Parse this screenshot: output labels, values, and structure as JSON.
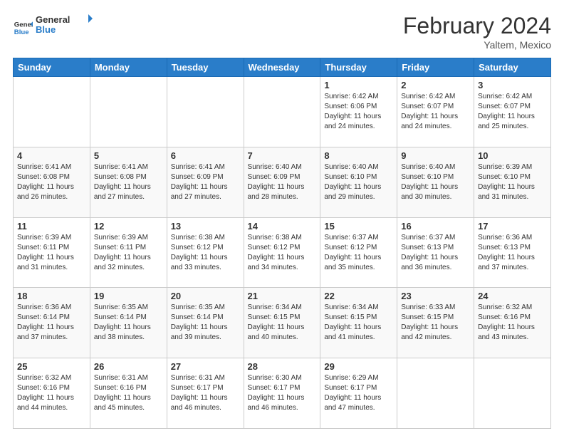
{
  "header": {
    "logo": {
      "general": "General",
      "blue": "Blue"
    },
    "title": "February 2024",
    "subtitle": "Yaltem, Mexico"
  },
  "weekdays": [
    "Sunday",
    "Monday",
    "Tuesday",
    "Wednesday",
    "Thursday",
    "Friday",
    "Saturday"
  ],
  "weeks": [
    [
      {
        "day": "",
        "info": ""
      },
      {
        "day": "",
        "info": ""
      },
      {
        "day": "",
        "info": ""
      },
      {
        "day": "",
        "info": ""
      },
      {
        "day": "1",
        "info": "Sunrise: 6:42 AM\nSunset: 6:06 PM\nDaylight: 11 hours and 24 minutes."
      },
      {
        "day": "2",
        "info": "Sunrise: 6:42 AM\nSunset: 6:07 PM\nDaylight: 11 hours and 24 minutes."
      },
      {
        "day": "3",
        "info": "Sunrise: 6:42 AM\nSunset: 6:07 PM\nDaylight: 11 hours and 25 minutes."
      }
    ],
    [
      {
        "day": "4",
        "info": "Sunrise: 6:41 AM\nSunset: 6:08 PM\nDaylight: 11 hours and 26 minutes."
      },
      {
        "day": "5",
        "info": "Sunrise: 6:41 AM\nSunset: 6:08 PM\nDaylight: 11 hours and 27 minutes."
      },
      {
        "day": "6",
        "info": "Sunrise: 6:41 AM\nSunset: 6:09 PM\nDaylight: 11 hours and 27 minutes."
      },
      {
        "day": "7",
        "info": "Sunrise: 6:40 AM\nSunset: 6:09 PM\nDaylight: 11 hours and 28 minutes."
      },
      {
        "day": "8",
        "info": "Sunrise: 6:40 AM\nSunset: 6:10 PM\nDaylight: 11 hours and 29 minutes."
      },
      {
        "day": "9",
        "info": "Sunrise: 6:40 AM\nSunset: 6:10 PM\nDaylight: 11 hours and 30 minutes."
      },
      {
        "day": "10",
        "info": "Sunrise: 6:39 AM\nSunset: 6:10 PM\nDaylight: 11 hours and 31 minutes."
      }
    ],
    [
      {
        "day": "11",
        "info": "Sunrise: 6:39 AM\nSunset: 6:11 PM\nDaylight: 11 hours and 31 minutes."
      },
      {
        "day": "12",
        "info": "Sunrise: 6:39 AM\nSunset: 6:11 PM\nDaylight: 11 hours and 32 minutes."
      },
      {
        "day": "13",
        "info": "Sunrise: 6:38 AM\nSunset: 6:12 PM\nDaylight: 11 hours and 33 minutes."
      },
      {
        "day": "14",
        "info": "Sunrise: 6:38 AM\nSunset: 6:12 PM\nDaylight: 11 hours and 34 minutes."
      },
      {
        "day": "15",
        "info": "Sunrise: 6:37 AM\nSunset: 6:12 PM\nDaylight: 11 hours and 35 minutes."
      },
      {
        "day": "16",
        "info": "Sunrise: 6:37 AM\nSunset: 6:13 PM\nDaylight: 11 hours and 36 minutes."
      },
      {
        "day": "17",
        "info": "Sunrise: 6:36 AM\nSunset: 6:13 PM\nDaylight: 11 hours and 37 minutes."
      }
    ],
    [
      {
        "day": "18",
        "info": "Sunrise: 6:36 AM\nSunset: 6:14 PM\nDaylight: 11 hours and 37 minutes."
      },
      {
        "day": "19",
        "info": "Sunrise: 6:35 AM\nSunset: 6:14 PM\nDaylight: 11 hours and 38 minutes."
      },
      {
        "day": "20",
        "info": "Sunrise: 6:35 AM\nSunset: 6:14 PM\nDaylight: 11 hours and 39 minutes."
      },
      {
        "day": "21",
        "info": "Sunrise: 6:34 AM\nSunset: 6:15 PM\nDaylight: 11 hours and 40 minutes."
      },
      {
        "day": "22",
        "info": "Sunrise: 6:34 AM\nSunset: 6:15 PM\nDaylight: 11 hours and 41 minutes."
      },
      {
        "day": "23",
        "info": "Sunrise: 6:33 AM\nSunset: 6:15 PM\nDaylight: 11 hours and 42 minutes."
      },
      {
        "day": "24",
        "info": "Sunrise: 6:32 AM\nSunset: 6:16 PM\nDaylight: 11 hours and 43 minutes."
      }
    ],
    [
      {
        "day": "25",
        "info": "Sunrise: 6:32 AM\nSunset: 6:16 PM\nDaylight: 11 hours and 44 minutes."
      },
      {
        "day": "26",
        "info": "Sunrise: 6:31 AM\nSunset: 6:16 PM\nDaylight: 11 hours and 45 minutes."
      },
      {
        "day": "27",
        "info": "Sunrise: 6:31 AM\nSunset: 6:17 PM\nDaylight: 11 hours and 46 minutes."
      },
      {
        "day": "28",
        "info": "Sunrise: 6:30 AM\nSunset: 6:17 PM\nDaylight: 11 hours and 46 minutes."
      },
      {
        "day": "29",
        "info": "Sunrise: 6:29 AM\nSunset: 6:17 PM\nDaylight: 11 hours and 47 minutes."
      },
      {
        "day": "",
        "info": ""
      },
      {
        "day": "",
        "info": ""
      }
    ]
  ]
}
